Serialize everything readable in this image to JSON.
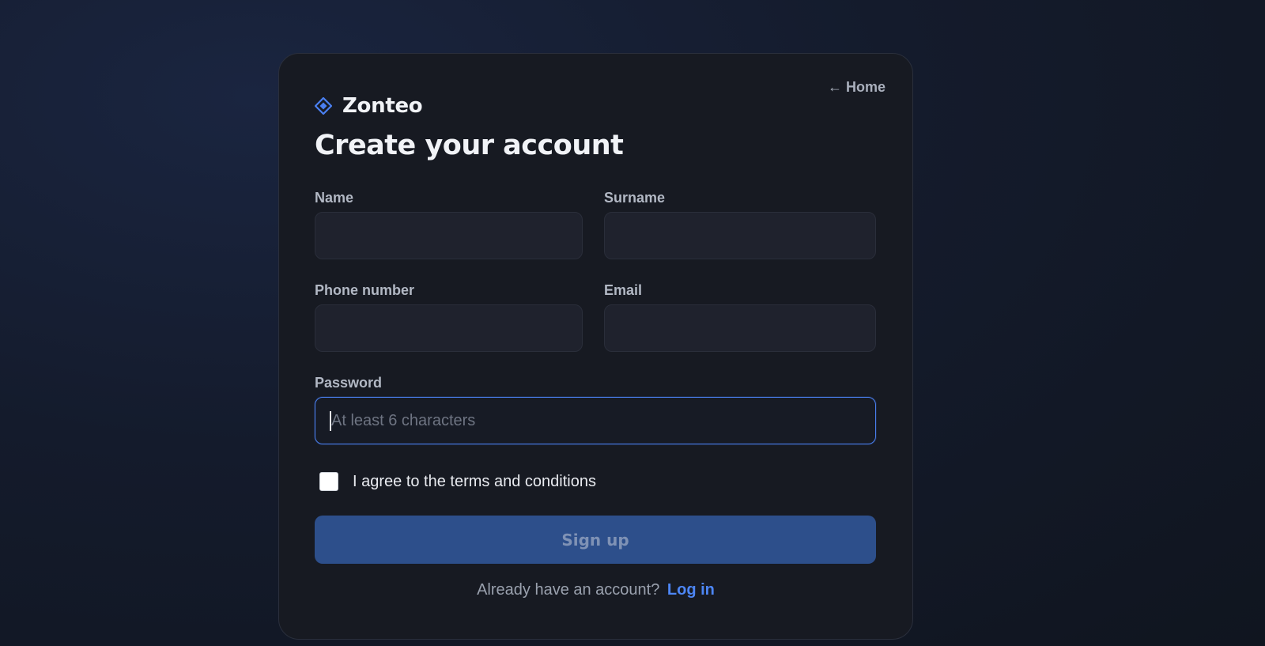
{
  "nav": {
    "home_arrow": "←",
    "home_label": "Home"
  },
  "brand": {
    "name": "Zonteo",
    "icon": "diamond-logo-icon",
    "accent_color": "#4a7ff0"
  },
  "form": {
    "title": "Create your account",
    "fields": {
      "name": {
        "label": "Name",
        "value": "",
        "placeholder": ""
      },
      "surname": {
        "label": "Surname",
        "value": "",
        "placeholder": ""
      },
      "phone": {
        "label": "Phone number",
        "value": "",
        "placeholder": ""
      },
      "email": {
        "label": "Email",
        "value": "",
        "placeholder": ""
      },
      "password": {
        "label": "Password",
        "value": "",
        "placeholder": "At least 6 characters",
        "focused": true
      }
    },
    "terms": {
      "label": "I agree to the terms and conditions",
      "checked": false
    },
    "submit": {
      "label": "Sign up",
      "disabled": true,
      "color": "#2d4f8b"
    },
    "footer": {
      "prompt": "Already have an account?",
      "link_label": "Log in",
      "link_color": "#4d86f5"
    }
  }
}
